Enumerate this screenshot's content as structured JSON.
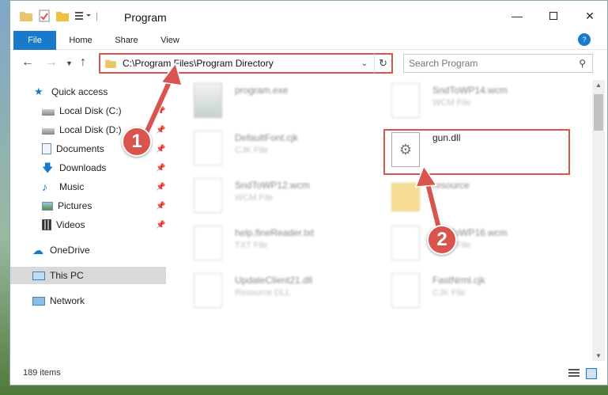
{
  "window": {
    "title": "Program",
    "minimize_icon": "minimize-icon",
    "maximize_icon": "maximize-icon",
    "close_icon": "close-icon"
  },
  "ribbon": {
    "tabs": [
      {
        "label": "File"
      },
      {
        "label": "Home"
      },
      {
        "label": "Share"
      },
      {
        "label": "View"
      }
    ]
  },
  "address": {
    "path": "C:\\Program Files\\Program Directory",
    "search_placeholder": "Search Program"
  },
  "sidebar": {
    "items": [
      {
        "label": "Quick access",
        "icon": "star-icon"
      },
      {
        "label": "Local Disk (C:)",
        "icon": "drive-icon"
      },
      {
        "label": "Local Disk (D:)",
        "icon": "drive-icon"
      },
      {
        "label": "Documents",
        "icon": "documents-icon"
      },
      {
        "label": "Downloads",
        "icon": "download-icon"
      },
      {
        "label": "Music",
        "icon": "music-icon"
      },
      {
        "label": "Pictures",
        "icon": "pictures-icon"
      },
      {
        "label": "Videos",
        "icon": "videos-icon"
      },
      {
        "label": "OneDrive",
        "icon": "cloud-icon"
      },
      {
        "label": "This PC",
        "icon": "computer-icon"
      },
      {
        "label": "Network",
        "icon": "network-icon"
      }
    ]
  },
  "files": [
    {
      "name": "program.exe",
      "type": ""
    },
    {
      "name": "SndToWP14.wcm",
      "type": "WCM File"
    },
    {
      "name": "DefaultFont.cjk",
      "type": "CJK File"
    },
    {
      "name": "gun.dll",
      "type": ""
    },
    {
      "name": "SndToWP12.wcm",
      "type": "WCM File"
    },
    {
      "name": "resource",
      "type": ""
    },
    {
      "name": "help.fineReader.txt",
      "type": "TXT File"
    },
    {
      "name": "SndToWP16.wcm",
      "type": "WCM File"
    },
    {
      "name": "UpdateClient21.dll",
      "type": "Resource DLL"
    },
    {
      "name": "FastNrml.cjk",
      "type": "CJK File"
    }
  ],
  "status": {
    "item_count": "189 items"
  },
  "callouts": [
    "1",
    "2"
  ],
  "colors": {
    "accent": "#1979ca",
    "highlight": "#d9534f"
  }
}
